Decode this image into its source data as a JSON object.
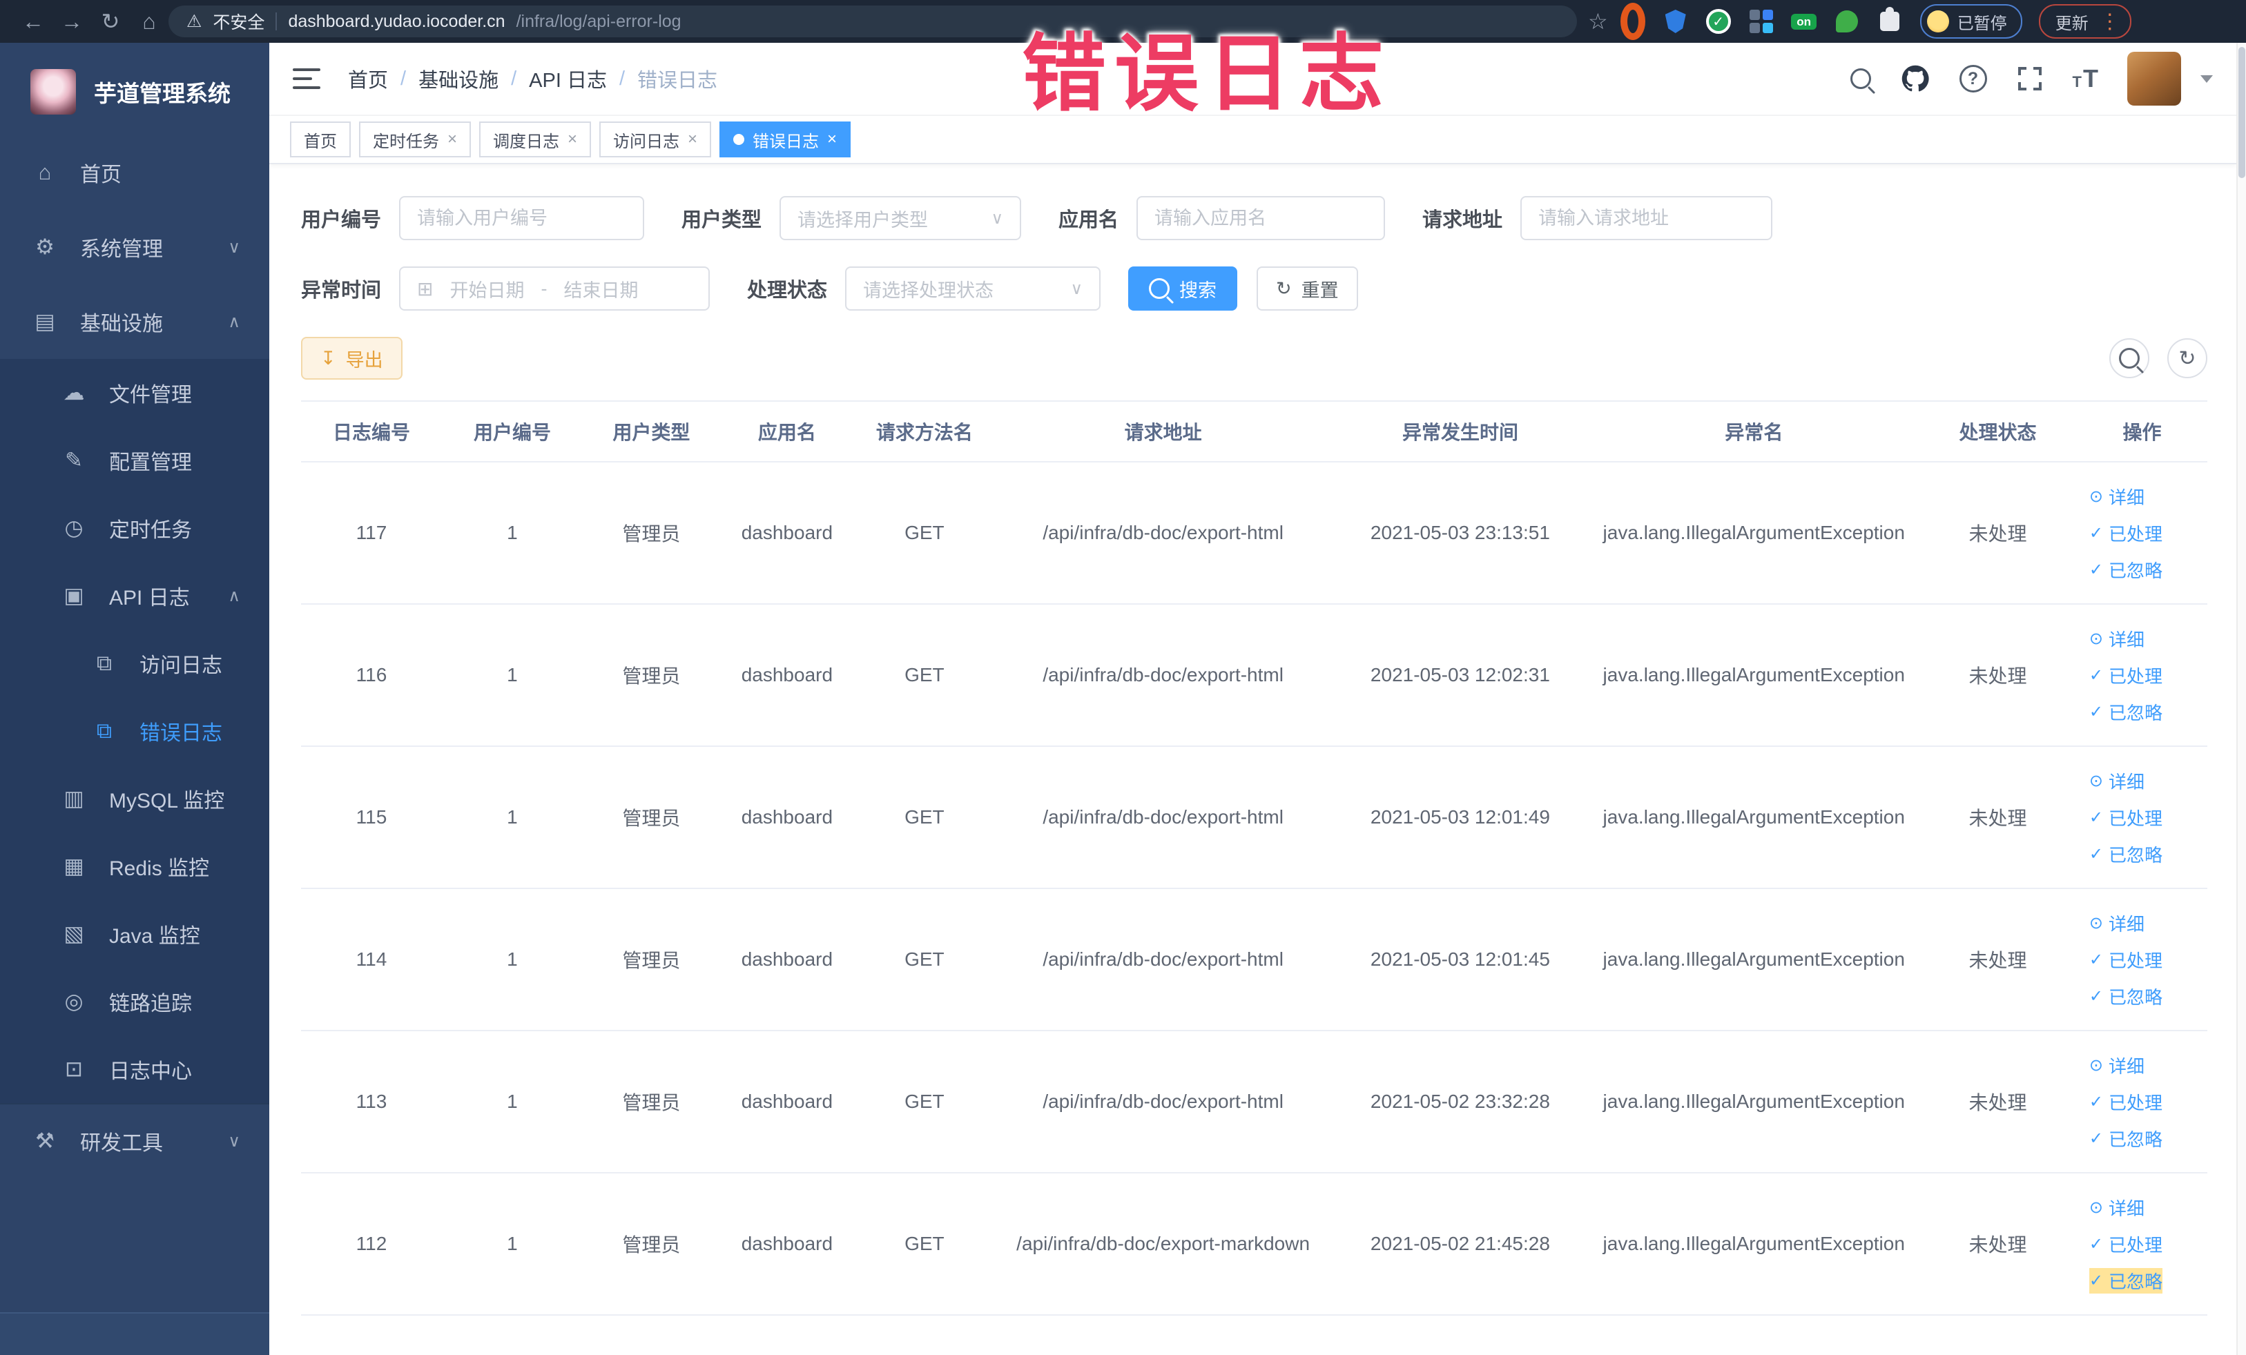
{
  "colors": {
    "accent": "#409eff",
    "overlay_text": "#ed3c63",
    "export_warning": "#e6a23c",
    "sidebar_bg": "#2e4468",
    "browser_bar_bg": "#1d2736"
  },
  "overlay": {
    "title": "错误日志"
  },
  "browser": {
    "security": "不安全",
    "host": "dashboard.yudao.iocoder.cn",
    "path": "/infra/log/api-error-log",
    "paused_chip": "已暂停",
    "update_button": "更新",
    "on_badge": "on"
  },
  "icons": {
    "back": "←",
    "forward": "→",
    "reload": "↻",
    "home": "⌂",
    "warning": "⚠",
    "star": "☆",
    "kebab": "⋮",
    "menu_home": "⌂",
    "menu_system": "⚙",
    "menu_infra": "▤",
    "menu_file": "☁",
    "menu_config": "✎",
    "menu_job": "◷",
    "menu_apilog": "▣",
    "menu_accesslog": "⧉",
    "menu_errorlog": "⧉",
    "menu_mysql": "▥",
    "menu_redis": "▦",
    "menu_java": "▧",
    "menu_trace": "◎",
    "menu_logcenter": "⊡",
    "menu_devtools": "⚒",
    "chevron_down": "∨",
    "chevron_up": "∧",
    "calendar": "⊞",
    "download": "↧",
    "refresh": "↻",
    "eye": "⊙",
    "check": "✓",
    "help": "?",
    "close": "×",
    "dash": "-"
  },
  "sidebar": {
    "title": "芋道管理系统",
    "menu": [
      {
        "label": "首页"
      },
      {
        "label": "系统管理"
      },
      {
        "label": "基础设施"
      },
      {
        "label": "文件管理"
      },
      {
        "label": "配置管理"
      },
      {
        "label": "定时任务"
      },
      {
        "label": "API 日志"
      },
      {
        "label": "访问日志"
      },
      {
        "label": "错误日志"
      },
      {
        "label": "MySQL 监控"
      },
      {
        "label": "Redis 监控"
      },
      {
        "label": "Java 监控"
      },
      {
        "label": "链路追踪"
      },
      {
        "label": "日志中心"
      },
      {
        "label": "研发工具"
      }
    ]
  },
  "header": {
    "breadcrumb": [
      "首页",
      "基础设施",
      "API 日志",
      "错误日志"
    ],
    "separator": "/"
  },
  "tabs": [
    {
      "label": "首页"
    },
    {
      "label": "定时任务"
    },
    {
      "label": "调度日志"
    },
    {
      "label": "访问日志"
    },
    {
      "label": "错误日志"
    }
  ],
  "filters": {
    "user_id": {
      "label": "用户编号",
      "placeholder": "请输入用户编号"
    },
    "user_type": {
      "label": "用户类型",
      "placeholder": "请选择用户类型"
    },
    "app_name": {
      "label": "应用名",
      "placeholder": "请输入应用名"
    },
    "request_url": {
      "label": "请求地址",
      "placeholder": "请输入请求地址"
    },
    "exception_time": {
      "label": "异常时间",
      "start_placeholder": "开始日期",
      "separator": "-",
      "end_placeholder": "结束日期"
    },
    "process_status": {
      "label": "处理状态",
      "placeholder": "请选择处理状态"
    },
    "search_button": "搜索",
    "reset_button": "重置"
  },
  "toolbar": {
    "export_button": "导出"
  },
  "table": {
    "columns": [
      "日志编号",
      "用户编号",
      "用户类型",
      "应用名",
      "请求方法名",
      "请求地址",
      "异常发生时间",
      "异常名",
      "处理状态",
      "操作"
    ],
    "ops": {
      "detail": "详细",
      "processed": "已处理",
      "ignored": "已忽略"
    },
    "rows": [
      {
        "id": "117",
        "user_id": "1",
        "user_type": "管理员",
        "app": "dashboard",
        "method": "GET",
        "url": "/api/infra/db-doc/export-html",
        "time": "2021-05-03 23:13:51",
        "exception": "java.lang.IllegalArgumentException",
        "status": "未处理"
      },
      {
        "id": "116",
        "user_id": "1",
        "user_type": "管理员",
        "app": "dashboard",
        "method": "GET",
        "url": "/api/infra/db-doc/export-html",
        "time": "2021-05-03 12:02:31",
        "exception": "java.lang.IllegalArgumentException",
        "status": "未处理"
      },
      {
        "id": "115",
        "user_id": "1",
        "user_type": "管理员",
        "app": "dashboard",
        "method": "GET",
        "url": "/api/infra/db-doc/export-html",
        "time": "2021-05-03 12:01:49",
        "exception": "java.lang.IllegalArgumentException",
        "status": "未处理"
      },
      {
        "id": "114",
        "user_id": "1",
        "user_type": "管理员",
        "app": "dashboard",
        "method": "GET",
        "url": "/api/infra/db-doc/export-html",
        "time": "2021-05-03 12:01:45",
        "exception": "java.lang.IllegalArgumentException",
        "status": "未处理"
      },
      {
        "id": "113",
        "user_id": "1",
        "user_type": "管理员",
        "app": "dashboard",
        "method": "GET",
        "url": "/api/infra/db-doc/export-html",
        "time": "2021-05-02 23:32:28",
        "exception": "java.lang.IllegalArgumentException",
        "status": "未处理"
      },
      {
        "id": "112",
        "user_id": "1",
        "user_type": "管理员",
        "app": "dashboard",
        "method": "GET",
        "url": "/api/infra/db-doc/export-markdown",
        "time": "2021-05-02 21:45:28",
        "exception": "java.lang.IllegalArgumentException",
        "status": "未处理"
      }
    ]
  }
}
